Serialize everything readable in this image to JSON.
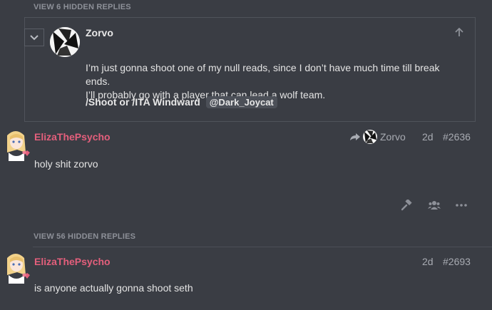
{
  "top": {
    "hidden_replies_label": "VIEW 6 HIDDEN REPLIES"
  },
  "quote": {
    "author": "Zorvo",
    "body_line1": "I’m just gonna shoot one of my null reads, since I don’t have much time till break ends.",
    "body_line2": "I’ll probably go with a player that can lead a wolf team.",
    "shoot_text": "/Shoot or /ITA Windward",
    "mention": "@Dark_Joycat"
  },
  "post1": {
    "author": "ElizaThePsycho",
    "reply_to": "Zorvo",
    "age": "2d",
    "number": "#2636",
    "body": "holy shit zorvo"
  },
  "middle": {
    "hidden_replies_label": "VIEW 56 HIDDEN REPLIES"
  },
  "post2": {
    "author": "ElizaThePsycho",
    "age": "2d",
    "number": "#2693",
    "body": "is anyone actually gonna shoot seth"
  },
  "colors": {
    "background": "#3a3d44",
    "username_accent": "#e45f7c",
    "muted_text": "#a8abb2"
  },
  "icons": [
    "chevron-down-icon",
    "arrow-up-icon",
    "reply-arrow-icon",
    "gavel-icon",
    "users-icon",
    "more-icon"
  ]
}
